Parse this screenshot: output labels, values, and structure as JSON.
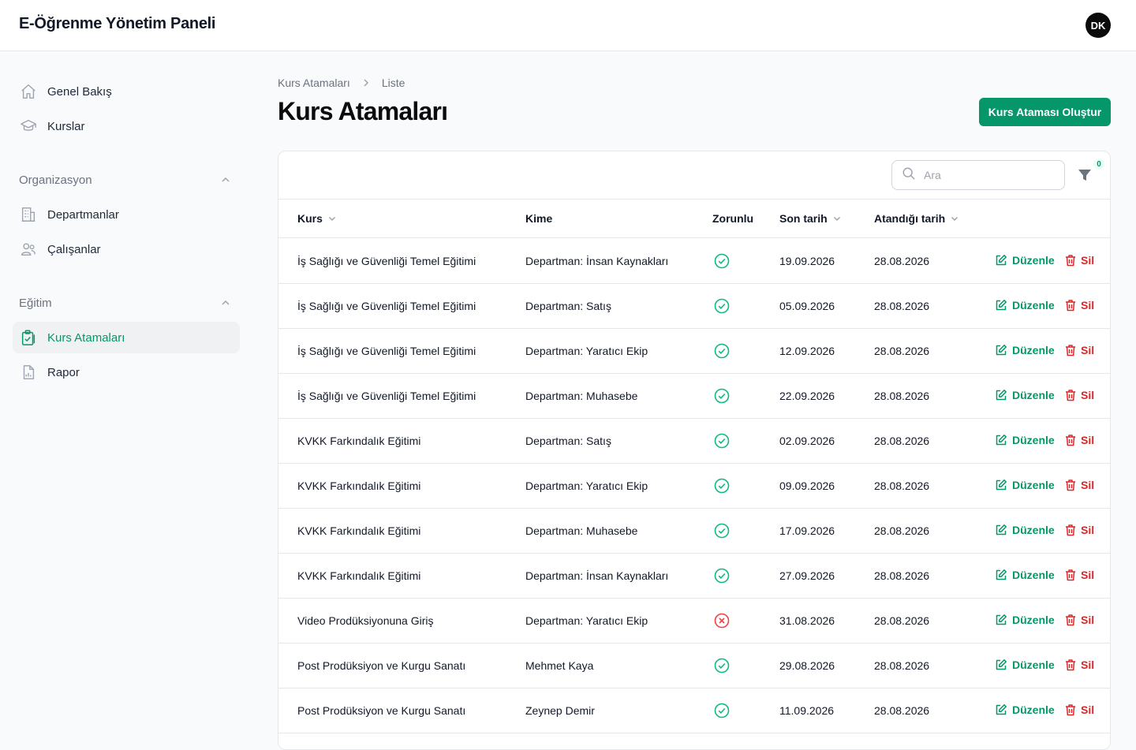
{
  "app": {
    "title": "E-Öğrenme Yönetim Paneli",
    "avatar_initials": "DK"
  },
  "colors": {
    "accent": "#059669",
    "danger": "#dc2626",
    "check": "#10b981",
    "cross": "#ef4444"
  },
  "sidebar": {
    "top_items": [
      {
        "label": "Genel Bakış",
        "icon": "home-icon"
      },
      {
        "label": "Kurslar",
        "icon": "graduation-cap-icon"
      }
    ],
    "groups": [
      {
        "label": "Organizasyon",
        "expanded": true,
        "items": [
          {
            "label": "Departmanlar",
            "icon": "building-icon"
          },
          {
            "label": "Çalışanlar",
            "icon": "users-icon"
          }
        ]
      },
      {
        "label": "Eğitim",
        "expanded": true,
        "items": [
          {
            "label": "Kurs Atamaları",
            "icon": "clipboard-check-icon",
            "active": true
          },
          {
            "label": "Rapor",
            "icon": "report-file-icon"
          }
        ]
      }
    ]
  },
  "breadcrumb": [
    "Kurs Atamaları",
    "Liste"
  ],
  "page": {
    "title": "Kurs Atamaları",
    "create_button": "Kurs Ataması Oluştur"
  },
  "search": {
    "placeholder": "Ara",
    "value": ""
  },
  "filter": {
    "count": "0"
  },
  "table": {
    "columns": [
      "Kurs",
      "Kime",
      "Zorunlu",
      "Son tarih",
      "Atandığı tarih"
    ],
    "sortable": [
      true,
      false,
      false,
      true,
      true
    ],
    "edit_label": "Düzenle",
    "delete_label": "Sil",
    "rows": [
      {
        "course": "İş Sağlığı ve Güvenliği Temel Eğitimi",
        "assignee": "Departman: İnsan Kaynakları",
        "required": true,
        "due": "19.09.2026",
        "assigned": "28.08.2026"
      },
      {
        "course": "İş Sağlığı ve Güvenliği Temel Eğitimi",
        "assignee": "Departman: Satış",
        "required": true,
        "due": "05.09.2026",
        "assigned": "28.08.2026"
      },
      {
        "course": "İş Sağlığı ve Güvenliği Temel Eğitimi",
        "assignee": "Departman: Yaratıcı Ekip",
        "required": true,
        "due": "12.09.2026",
        "assigned": "28.08.2026"
      },
      {
        "course": "İş Sağlığı ve Güvenliği Temel Eğitimi",
        "assignee": "Departman: Muhasebe",
        "required": true,
        "due": "22.09.2026",
        "assigned": "28.08.2026"
      },
      {
        "course": "KVKK Farkındalık Eğitimi",
        "assignee": "Departman: Satış",
        "required": true,
        "due": "02.09.2026",
        "assigned": "28.08.2026"
      },
      {
        "course": "KVKK Farkındalık Eğitimi",
        "assignee": "Departman: Yaratıcı Ekip",
        "required": true,
        "due": "09.09.2026",
        "assigned": "28.08.2026"
      },
      {
        "course": "KVKK Farkındalık Eğitimi",
        "assignee": "Departman: Muhasebe",
        "required": true,
        "due": "17.09.2026",
        "assigned": "28.08.2026"
      },
      {
        "course": "KVKK Farkındalık Eğitimi",
        "assignee": "Departman: İnsan Kaynakları",
        "required": true,
        "due": "27.09.2026",
        "assigned": "28.08.2026"
      },
      {
        "course": "Video Prodüksiyonuna Giriş",
        "assignee": "Departman: Yaratıcı Ekip",
        "required": false,
        "due": "31.08.2026",
        "assigned": "28.08.2026"
      },
      {
        "course": "Post Prodüksiyon ve Kurgu Sanatı",
        "assignee": "Mehmet Kaya",
        "required": true,
        "due": "29.08.2026",
        "assigned": "28.08.2026"
      },
      {
        "course": "Post Prodüksiyon ve Kurgu Sanatı",
        "assignee": "Zeynep Demir",
        "required": true,
        "due": "11.09.2026",
        "assigned": "28.08.2026"
      }
    ]
  }
}
